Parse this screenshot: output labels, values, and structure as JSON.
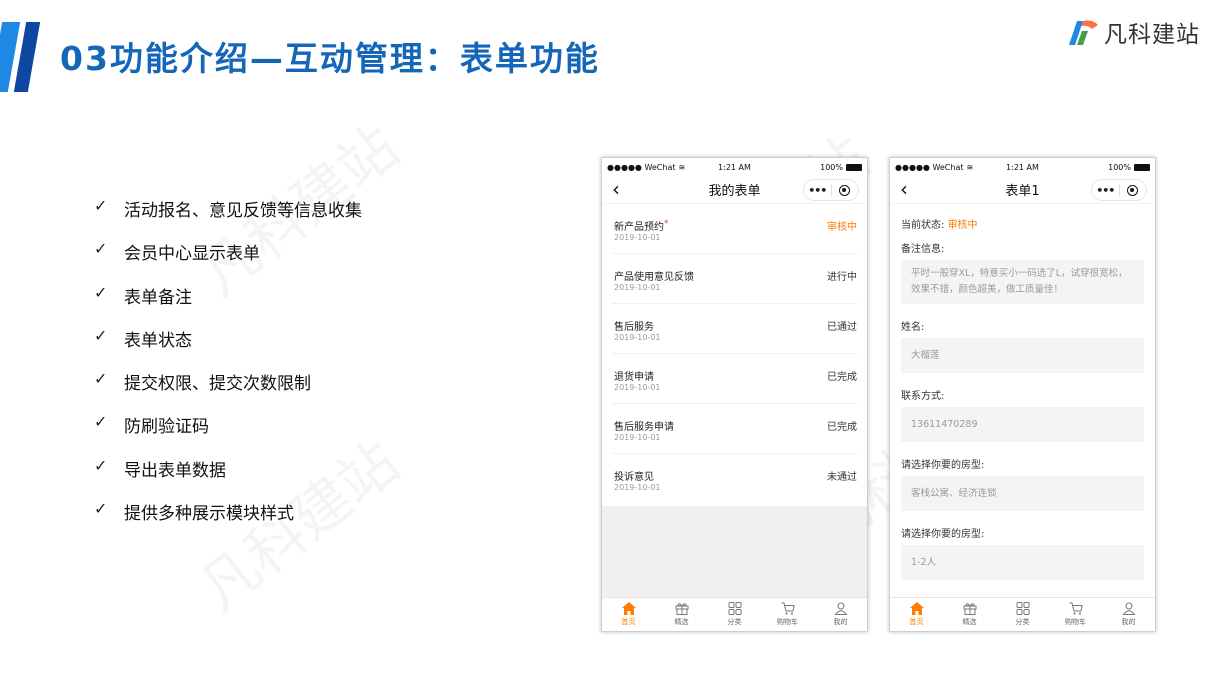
{
  "slide": {
    "title": "03功能介绍—互动管理：表单功能",
    "logo_text": "凡科建站",
    "watermark": "凡科建站",
    "accent_color": "#1466b8"
  },
  "features": [
    "活动报名、意见反馈等信息收集",
    "会员中心显示表单",
    "表单备注",
    "表单状态",
    "提交权限、提交次数限制",
    "防刷验证码",
    "导出表单数据",
    "提供多种展示模块样式"
  ],
  "status_bar": {
    "carrier": "●●●●● WeChat",
    "time": "1:21 AM",
    "battery": "100%"
  },
  "list_phone": {
    "title": "我的表单",
    "rows": [
      {
        "name": "新产品预约",
        "required": "*",
        "date": "2019-10-01",
        "status": "审核中",
        "highlight": true
      },
      {
        "name": "产品使用意见反馈",
        "required": "",
        "date": "2019-10-01",
        "status": "进行中",
        "highlight": false
      },
      {
        "name": "售后服务",
        "required": "",
        "date": "2019-10-01",
        "status": "已通过",
        "highlight": false
      },
      {
        "name": "退货申请",
        "required": "",
        "date": "2019-10-01",
        "status": "已完成",
        "highlight": false
      },
      {
        "name": "售后服务申请",
        "required": "",
        "date": "2019-10-01",
        "status": "已完成",
        "highlight": false
      },
      {
        "name": "投诉意见",
        "required": "",
        "date": "2019-10-01",
        "status": "未通过",
        "highlight": false
      }
    ]
  },
  "detail_phone": {
    "title": "表单1",
    "state_label": "当前状态:",
    "state_value": "审核中",
    "note_label": "备注信息:",
    "note_value": "平时一般穿XL，特意买小一码选了L，试穿很宽松，效果不错，颜色超美，做工质量佳！",
    "name_label": "姓名:",
    "name_value": "大榴莲",
    "contact_label": "联系方式:",
    "contact_value": "13611470289",
    "room_label_1": "请选择你要的房型:",
    "room_value_1": "客栈公寓、经济连锁",
    "room_label_2": "请选择你要的房型:",
    "room_value_2": "1-2人"
  },
  "tab_bar": [
    {
      "label": "首页",
      "icon": "home-icon",
      "active": true
    },
    {
      "label": "精选",
      "icon": "gift-icon",
      "active": false
    },
    {
      "label": "分类",
      "icon": "grid-icon",
      "active": false
    },
    {
      "label": "购物车",
      "icon": "cart-icon",
      "active": false
    },
    {
      "label": "我的",
      "icon": "user-icon",
      "active": false
    }
  ],
  "colors": {
    "highlight": "#ff7a00",
    "title": "#1466b8"
  }
}
